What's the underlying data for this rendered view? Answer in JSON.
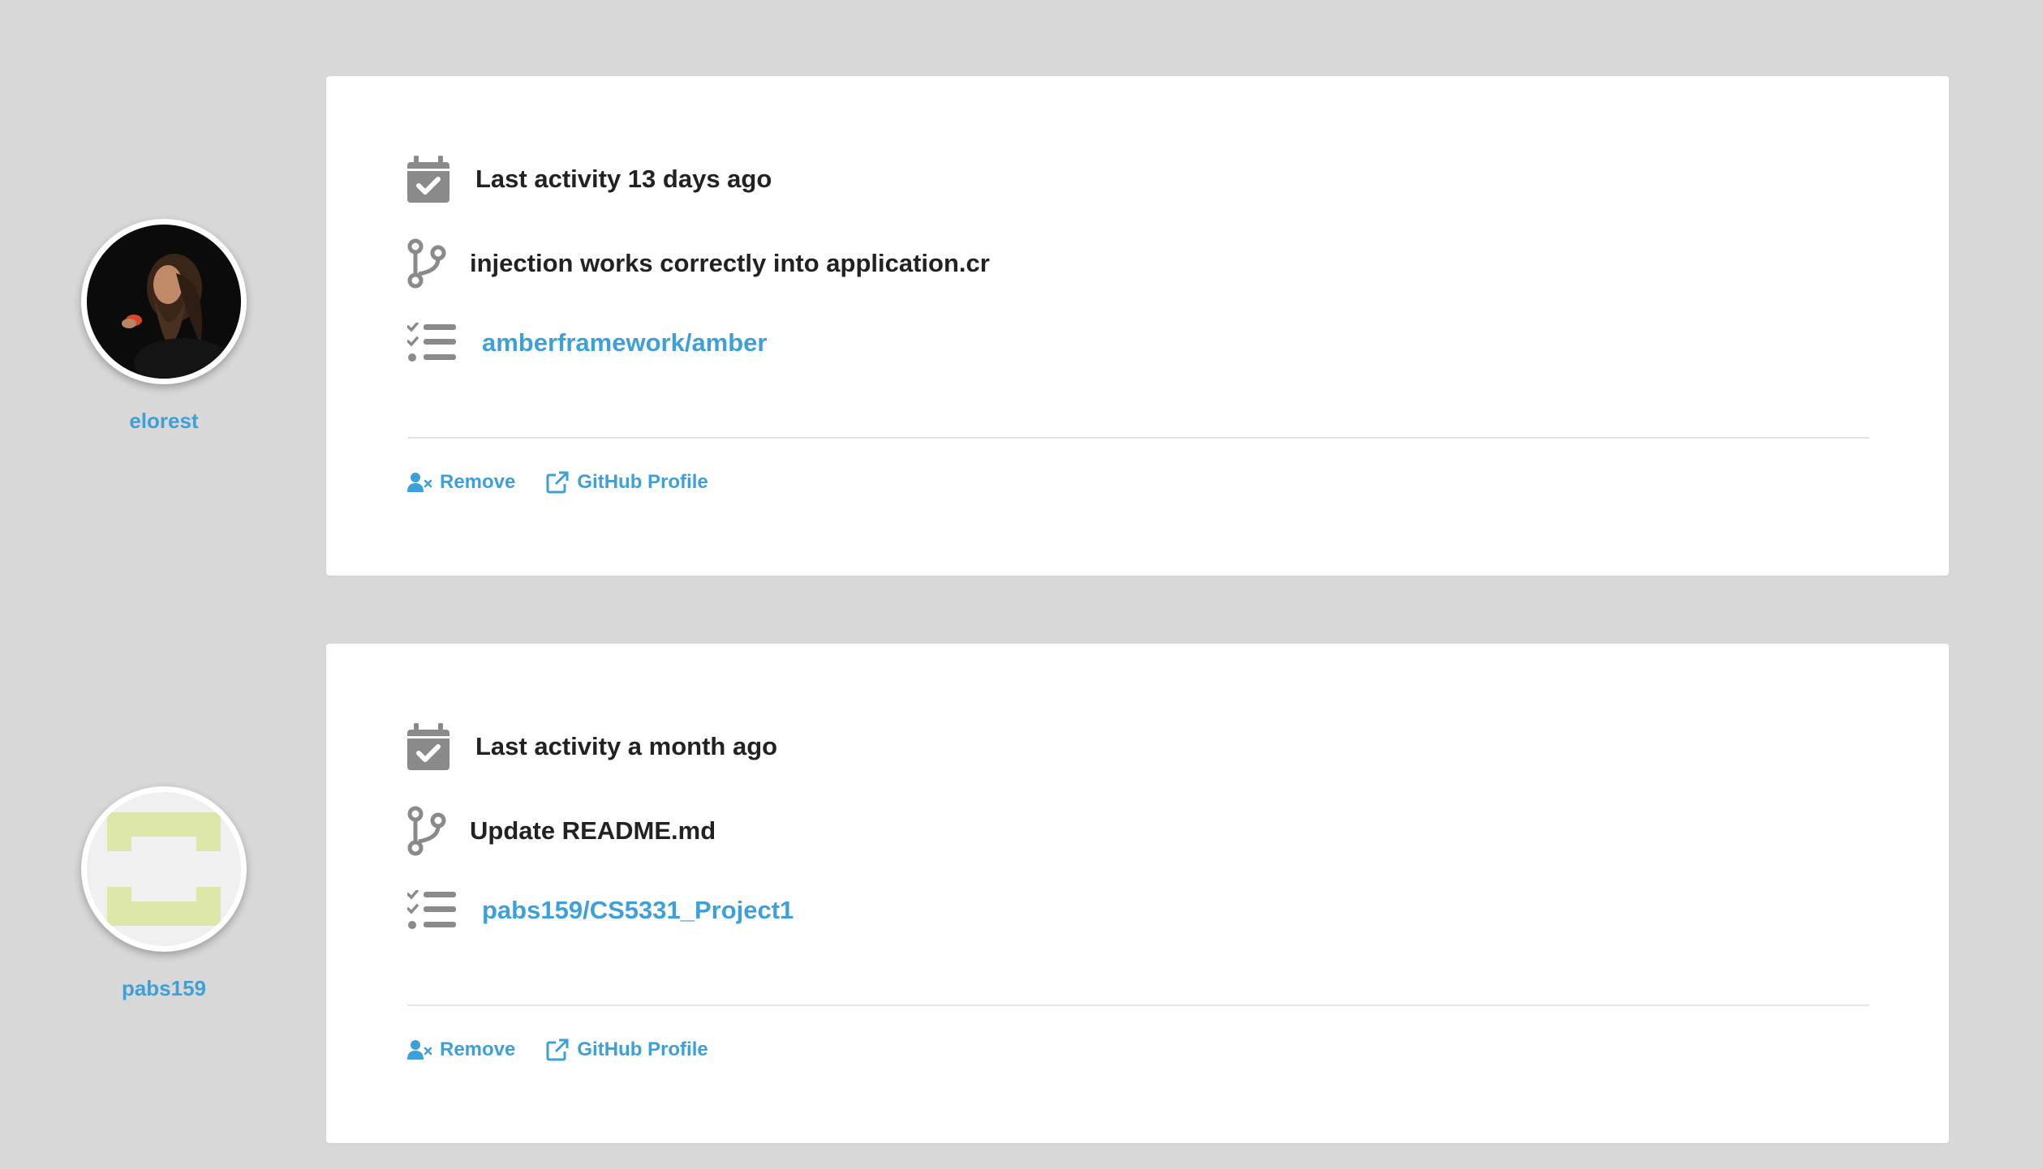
{
  "colors": {
    "background": "#d8d8d8",
    "card": "#ffffff",
    "link": "#3ea0d9",
    "text": "#222222",
    "icon": "#8a8a8a"
  },
  "entries": [
    {
      "username": "elorest",
      "avatar": "person-photo",
      "last_activity": "Last activity 13 days ago",
      "commit_message": "injection works correctly into application.cr",
      "repository": "amberframework/amber",
      "actions": {
        "remove": "Remove",
        "github_profile": "GitHub Profile"
      }
    },
    {
      "username": "pabs159",
      "avatar": "identicon-green",
      "last_activity": "Last activity a month ago",
      "commit_message": "Update README.md",
      "repository": "pabs159/CS5331_Project1",
      "actions": {
        "remove": "Remove",
        "github_profile": "GitHub Profile"
      }
    }
  ]
}
